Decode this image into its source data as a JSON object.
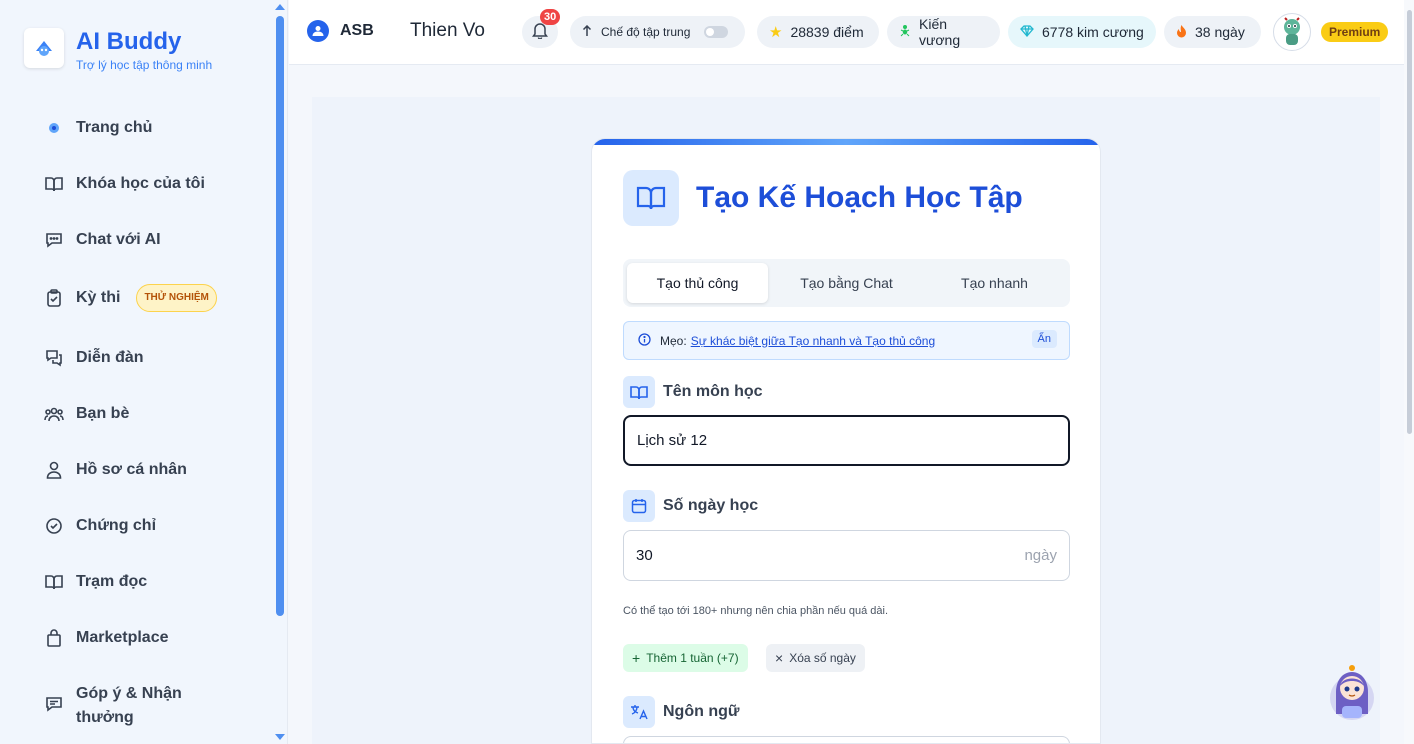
{
  "brand": {
    "title": "AI Buddy",
    "subtitle": "Trợ lý học tập thông minh"
  },
  "sidebar": {
    "items": [
      {
        "label": "Trang chủ",
        "icon": "home-logo-icon"
      },
      {
        "label": "Khóa học của tôi",
        "icon": "book-icon"
      },
      {
        "label": "Chat với AI",
        "icon": "chat-icon"
      },
      {
        "label": "Kỳ thi",
        "icon": "clipboard-check-icon",
        "badge": "THỬ NGHIỆM"
      },
      {
        "label": "Diễn đàn",
        "icon": "forum-icon"
      },
      {
        "label": "Bạn bè",
        "icon": "users-icon"
      },
      {
        "label": "Hồ sơ cá nhân",
        "icon": "user-icon"
      },
      {
        "label": "Chứng chỉ",
        "icon": "check-circle-icon"
      },
      {
        "label": "Trạm đọc",
        "icon": "book-open-icon"
      },
      {
        "label": "Marketplace",
        "icon": "bag-icon"
      },
      {
        "label": "Góp ý & Nhận thưởng",
        "icon": "feedback-icon"
      }
    ]
  },
  "header": {
    "org": "ASB",
    "user_name": "Thien Vo",
    "notification_count": "30",
    "focus_mode_label": "Chế độ tập trung",
    "focus_mode_on": false,
    "points": "28839 điểm",
    "rank": "Kiến vương",
    "diamonds": "6778 kim cương",
    "streak": "38 ngày",
    "plan": "Premium"
  },
  "card": {
    "title": "Tạo Kế Hoạch Học Tập",
    "tabs": [
      "Tạo thủ công",
      "Tạo bằng Chat",
      "Tạo nhanh"
    ],
    "active_tab": 0,
    "tip": {
      "prefix": "Mẹo:",
      "link": "Sự khác biệt giữa Tạo nhanh và Tạo thủ công",
      "hide": "Ẩn"
    },
    "subject": {
      "label": "Tên môn học",
      "value": "Lịch sử 12"
    },
    "days": {
      "label": "Số ngày học",
      "value": "30",
      "suffix": "ngày",
      "hint": "Có thể tạo tới 180+ nhưng nên chia phần nếu quá dài."
    },
    "add_week": "Thêm 1 tuần (+7)",
    "clear_days": "Xóa số ngày",
    "language": {
      "label": "Ngôn ngữ"
    }
  },
  "colors": {
    "accent": "#2563eb",
    "premium": "#facc15",
    "notification": "#ef4444"
  }
}
